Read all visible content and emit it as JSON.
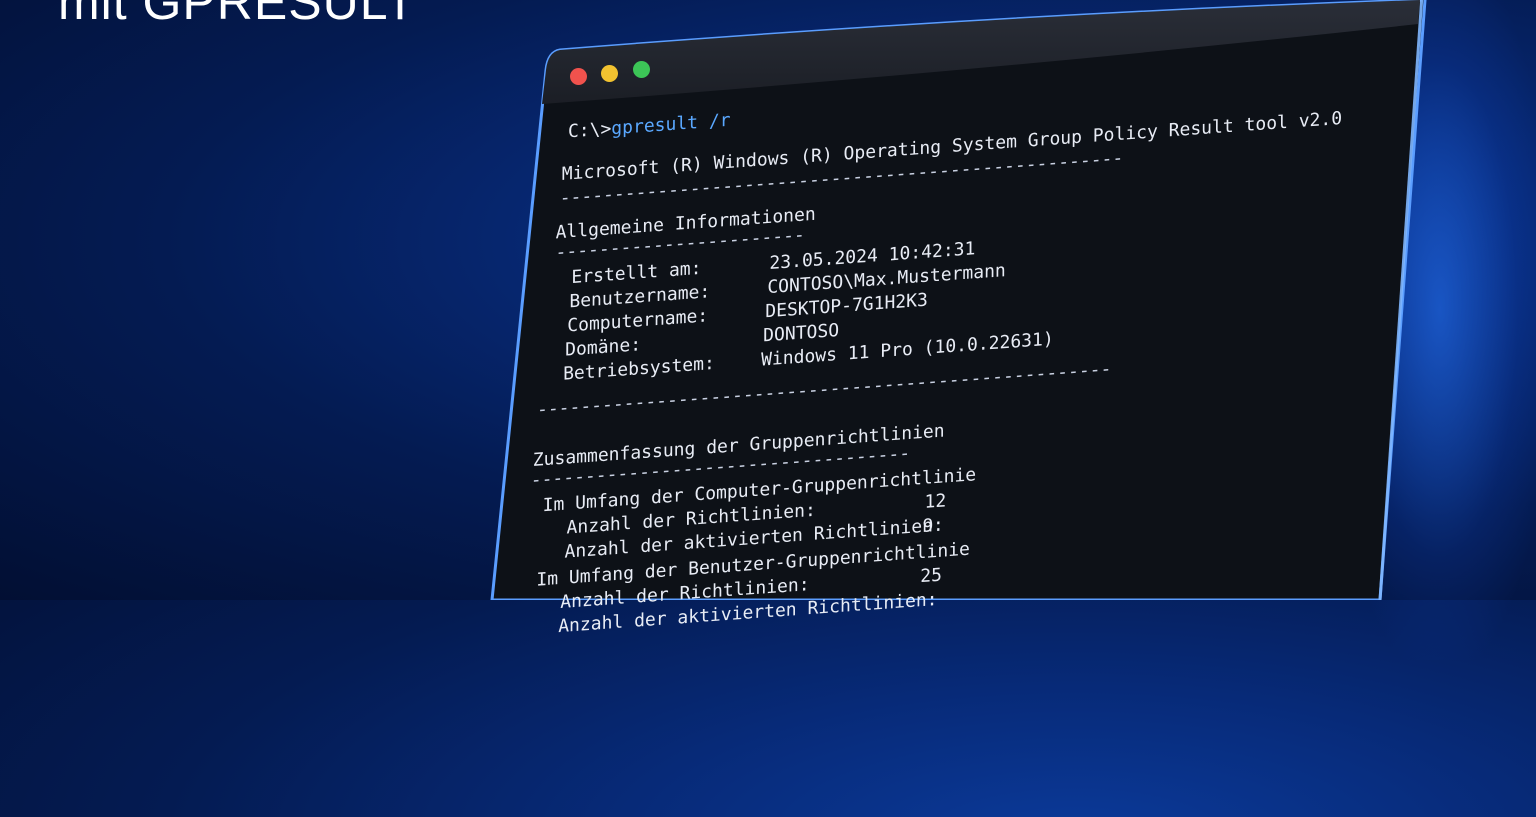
{
  "hero": {
    "title": "mit GPRESULT"
  },
  "terminal": {
    "prompt": "C:\\>",
    "command": "gpresult /r",
    "tool_line": "Microsoft (R) Windows (R) Operating System Group Policy Result tool v2.0",
    "divider_long": "----------------------------------------------------",
    "general_heading": "Allgemeine Informationen",
    "general_underline": "-----------------------",
    "fields": [
      {
        "label": "Erstellt am:",
        "value": "23.05.2024 10:42:31"
      },
      {
        "label": "Benutzername:",
        "value": "CONTOSO\\Max.Mustermann"
      },
      {
        "label": "Computername:",
        "value": "DESKTOP-7G1H2K3"
      },
      {
        "label": "Domäne:",
        "value": "DONTOSO"
      },
      {
        "label": "Betriebsystem:",
        "value": "Windows 11 Pro (10.0.22631)"
      }
    ],
    "divider_mid": "-----------------------------------------------------",
    "summary_heading": "Zusammenfassung der Gruppenrichtlinien",
    "summary_underline": "-----------------------------------",
    "computer_scope": "Im Umfang der Computer-Gruppenrichtlinie",
    "computer_count_label": "Anzahl der Richtlinien:",
    "computer_count_value": "12",
    "computer_active_label": "Anzahl der aktivierten Richtlinien:",
    "computer_active_value": "9",
    "user_scope": "Im Umfang der Benutzer-Gruppenrichtlinie",
    "user_count_label": "Anzahl der Richtlinien:",
    "user_count_value": "25",
    "user_active_label": "Anzahl der aktivierten Richtlinien:"
  }
}
